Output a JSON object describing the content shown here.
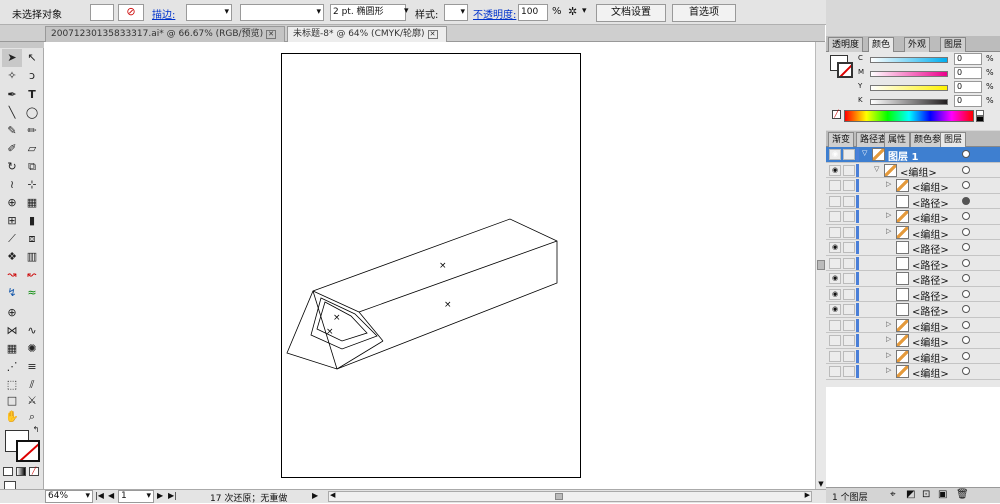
{
  "control_bar": {
    "selection_status": "未选择对象",
    "stroke_label": "描边:",
    "stroke_weight_text": "2 pt. 椭圆形",
    "style_label": "样式:",
    "opacity_label": "不透明度:",
    "opacity_value": "100",
    "opacity_unit": "%",
    "doc_setup_button": "文档设置",
    "preferences_button": "首选项"
  },
  "document_tabs": [
    {
      "label": "20071230135833317.ai* @ 66.67% (RGB/预览)"
    },
    {
      "label": "未标题-8* @ 64% (CMYK/轮廓)"
    }
  ],
  "color_panel": {
    "tabs": [
      "透明度",
      "颜色",
      "外观",
      "图层"
    ],
    "active_tab": "颜色",
    "channels": [
      {
        "label": "C",
        "value": "0",
        "unit": "%",
        "color": "#00aeef"
      },
      {
        "label": "M",
        "value": "0",
        "unit": "%",
        "color": "#ec008c"
      },
      {
        "label": "Y",
        "value": "0",
        "unit": "%",
        "color": "#fff200"
      },
      {
        "label": "K",
        "value": "0",
        "unit": "%",
        "color": "#231f20"
      }
    ]
  },
  "layers_panel": {
    "tabs": [
      "渐变",
      "路径查",
      "属性",
      "颜色参",
      "图层"
    ],
    "active_tab": "图层",
    "rows": [
      {
        "name": "图层 1",
        "level": 0,
        "expanded": true,
        "eye": true,
        "selected": true
      },
      {
        "name": "<编组>",
        "level": 1,
        "expanded": true,
        "eye": true
      },
      {
        "name": "<编组>",
        "level": 2,
        "expanded": false,
        "eye": false
      },
      {
        "name": "<路径>",
        "level": 2,
        "eye": false,
        "target_filled": true
      },
      {
        "name": "<编组>",
        "level": 2,
        "expanded": false,
        "eye": false
      },
      {
        "name": "<编组>",
        "level": 2,
        "expanded": false,
        "eye": false
      },
      {
        "name": "<路径>",
        "level": 2,
        "eye": true
      },
      {
        "name": "<路径>",
        "level": 2,
        "eye": false
      },
      {
        "name": "<路径>",
        "level": 2,
        "eye": true
      },
      {
        "name": "<路径>",
        "level": 2,
        "eye": true
      },
      {
        "name": "<路径>",
        "level": 2,
        "eye": true
      },
      {
        "name": "<编组>",
        "level": 2,
        "expanded": false,
        "eye": false
      },
      {
        "name": "<编组>",
        "level": 2,
        "expanded": false,
        "eye": false
      },
      {
        "name": "<编组>",
        "level": 2,
        "expanded": false,
        "eye": false
      },
      {
        "name": "<编组>",
        "level": 2,
        "expanded": false,
        "eye": false
      }
    ],
    "footer_count": "1 个图层"
  },
  "status_bar": {
    "zoom": "64%",
    "page": "1",
    "undo_text": "17 次还原；无重做"
  }
}
